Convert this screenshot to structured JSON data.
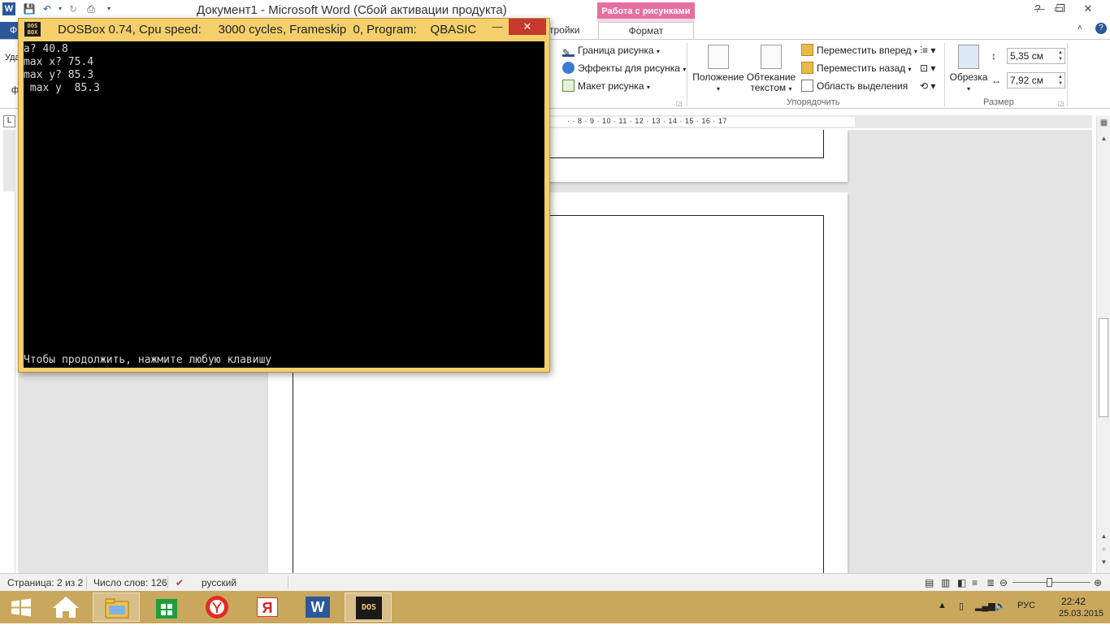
{
  "word": {
    "title": "Документ1  -  Microsoft Word (Сбой активации продукта)",
    "context_tab_group": "Работа с рисунками",
    "tabs": {
      "file": "Ф",
      "settings_tail": "тройки",
      "format": "Формат"
    },
    "ribbon": {
      "left_cut_1": "Уда",
      "left_cut_2": "ф",
      "border": "Граница рисунка",
      "effects": "Эффекты для рисунка",
      "layout": "Макет рисунка",
      "position": "Положение",
      "wrap_1": "Обтекание",
      "wrap_2": "текстом",
      "bring_forward": "Переместить вперед",
      "send_backward": "Переместить назад",
      "selection_pane": "Область выделения",
      "arrange_label": "Упорядочить",
      "crop": "Обрезка",
      "height": "5,35 см",
      "width": "7,92 см",
      "size_label": "Размер"
    },
    "ruler_numbers": "·  ·  8  ·  9  ·  10  ·  11  ·  12  ·  13  ·  14  ·  15  ·  16  ·  17",
    "status": {
      "page": "Страница: 2 из 2",
      "words": "Число слов: 126",
      "language": "русский"
    }
  },
  "dosbox": {
    "title": "DOSBox 0.74, Cpu speed:     3000 cycles, Frameskip  0, Program:    QBASIC",
    "icon_text_1": "DOS",
    "icon_text_2": "BOX",
    "lines": [
      "a? 40.8",
      "max x? 75.4",
      "max y? 85.3",
      " max y  85.3"
    ],
    "prompt": "Чтобы продолжить, нажмите любую клавишу"
  },
  "taskbar": {
    "lang": "РУС",
    "time": "22:42",
    "date": "25.03.2015",
    "word_label": "W",
    "yandex_label": "Я",
    "dosbox_label": "DOS"
  },
  "colors": {
    "word_blue": "#2b579a",
    "context_pink": "#e56fa0",
    "dosbox_frame": "#f4cf6b",
    "taskbar": "#c9a75c"
  }
}
